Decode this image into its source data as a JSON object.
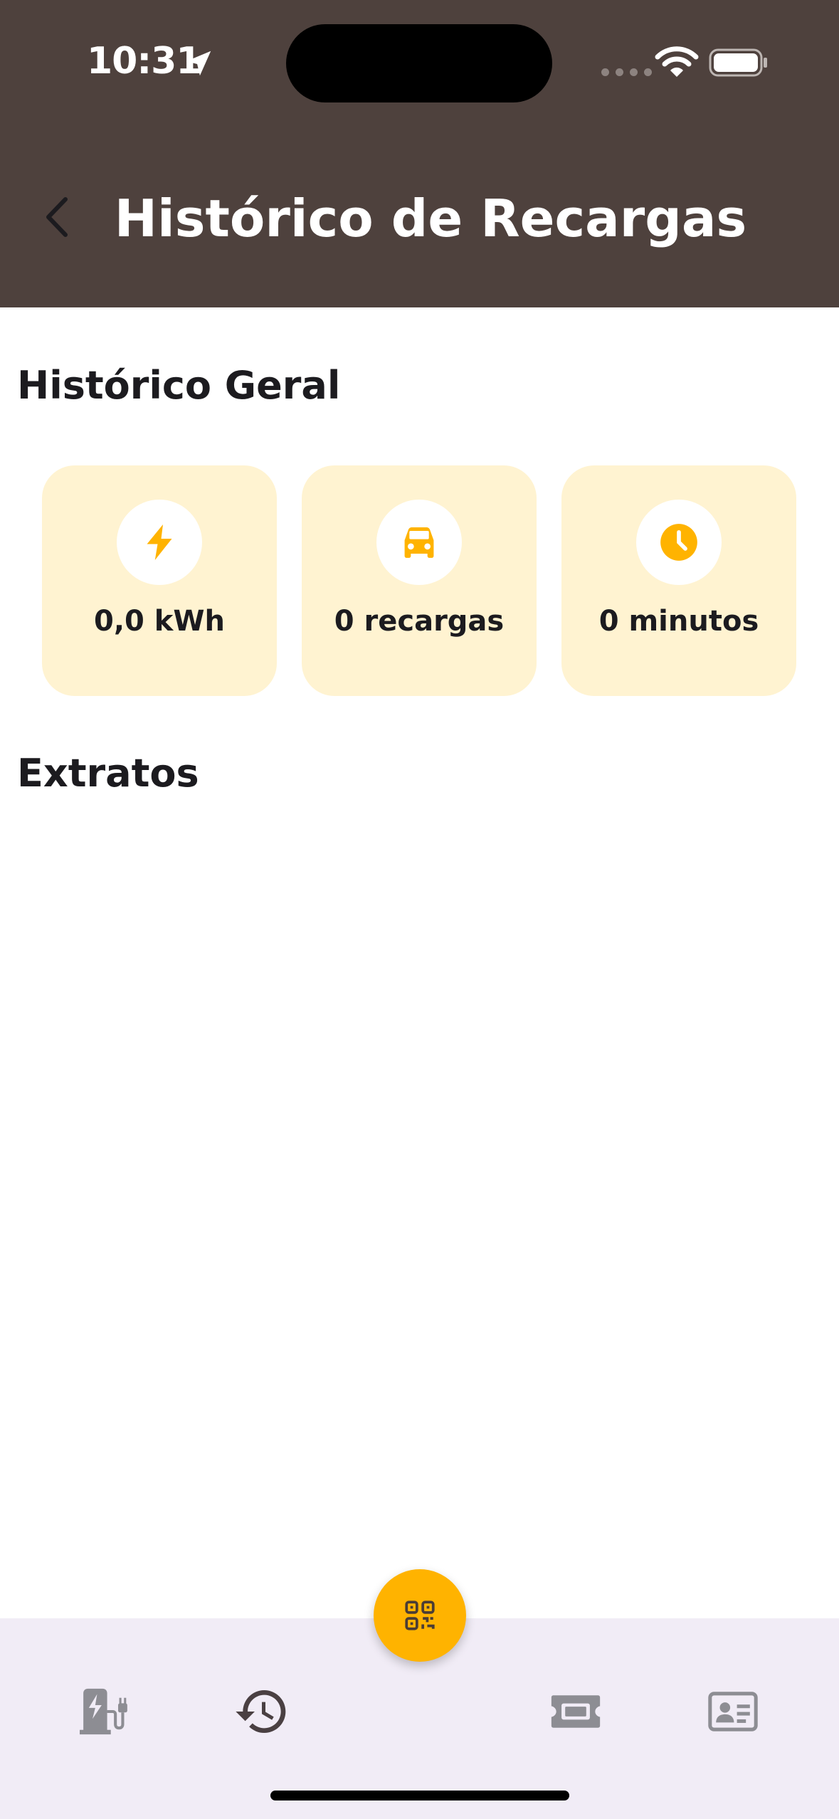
{
  "status_bar": {
    "time": "10:31"
  },
  "header": {
    "title": "Histórico de Recargas"
  },
  "sections": {
    "general_title": "Histórico Geral",
    "statements_title": "Extratos"
  },
  "stats": [
    {
      "icon": "bolt-icon",
      "label": "0,0 kWh"
    },
    {
      "icon": "car-icon",
      "label": "0 recargas"
    },
    {
      "icon": "clock-icon",
      "label": "0 minutos"
    }
  ],
  "bottom_nav": {
    "items": [
      "ev-charger-icon",
      "history-icon",
      "qr-code-icon",
      "ticket-icon",
      "id-card-icon"
    ],
    "active": "history-icon"
  },
  "colors": {
    "header_bg": "#4e413d",
    "accent": "#ffb300",
    "card_bg": "#fff3d1",
    "nav_bg": "#f1ecf6",
    "nav_icon": "#8d8d93"
  }
}
